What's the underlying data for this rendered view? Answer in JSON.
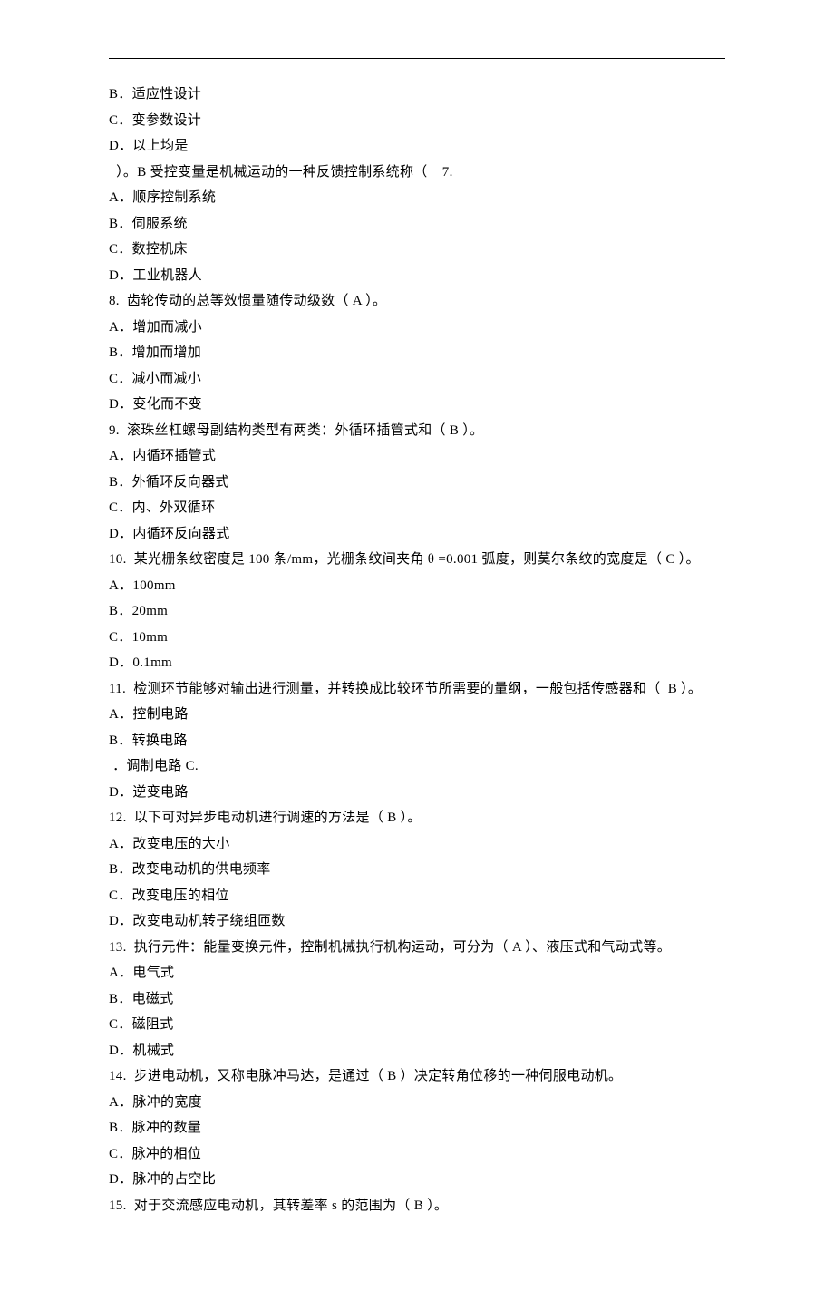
{
  "lines": [
    "B．适应性设计",
    "C．变参数设计",
    "D．以上均是",
    "  ）。B 受控变量是机械运动的一种反馈控制系统称（    7.",
    "A．顺序控制系统",
    "B．伺服系统",
    "C．数控机床",
    "D．工业机器人",
    "8.  齿轮传动的总等效惯量随传动级数（ A ）。",
    "A．增加而减小",
    "B．增加而增加",
    "C．减小而减小",
    "D．变化而不变",
    "9.  滚珠丝杠螺母副结构类型有两类：外循环插管式和（ B ）。",
    "A．内循环插管式",
    "B．外循环反向器式",
    "C．内、外双循环",
    "D．内循环反向器式",
    "10.  某光栅条纹密度是 100 条/mm，光栅条纹间夹角 θ =0.001 弧度，则莫尔条纹的宽度是（ C ）。",
    "A．100mm",
    "B．20mm",
    "C．10mm",
    "D．0.1mm",
    "11.  检测环节能够对输出进行测量，并转换成比较环节所需要的量纲，一般包括传感器和（  B ）。",
    "A．控制电路",
    "B．转换电路",
    " ．调制电路 C.",
    "D．逆变电路",
    "12.  以下可对异步电动机进行调速的方法是（ B ）。",
    "A．改变电压的大小",
    "B．改变电动机的供电频率",
    "C．改变电压的相位",
    "D．改变电动机转子绕组匝数",
    "13.  执行元件：能量变换元件，控制机械执行机构运动，可分为（ A ）、液压式和气动式等。",
    "A．电气式",
    "B．电磁式",
    "C．磁阻式",
    "D．机械式",
    "14.  步进电动机，又称电脉冲马达，是通过（ B ）决定转角位移的一种伺服电动机。",
    "A．脉冲的宽度",
    "B．脉冲的数量",
    "C．脉冲的相位",
    "D．脉冲的占空比",
    "15.  对于交流感应电动机，其转差率 s 的范围为（ B ）。"
  ]
}
